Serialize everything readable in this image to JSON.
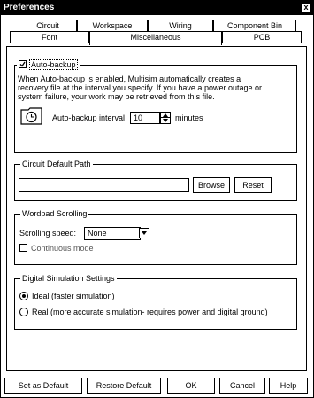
{
  "window": {
    "title": "Preferences",
    "close_label": "x"
  },
  "tabs": {
    "row1": [
      "Circuit",
      "Workspace",
      "Wiring",
      "Component Bin"
    ],
    "row2": [
      "Font",
      "Miscellaneous",
      "PCB"
    ],
    "active": "Miscellaneous"
  },
  "autobackup": {
    "label": "Auto-backup",
    "checked": true,
    "description": [
      "When Auto-backup is enabled, Multisim automatically creates a",
      "recovery file at the interval you specify. If you have a power outage or",
      "system failure, your work may be retrieved from this file."
    ],
    "interval_label": "Auto-backup interval",
    "interval_value": "10",
    "interval_unit": "minutes",
    "icon": "clock-icon"
  },
  "circuit_path": {
    "label": "Circuit Default Path",
    "value": "",
    "browse_label": "Browse",
    "reset_label": "Reset"
  },
  "wordpad": {
    "label": "Wordpad Scrolling",
    "speed_label": "Scrolling speed:",
    "speed_value": "None",
    "continuous_label": "Continuous mode",
    "continuous_checked": false
  },
  "digital_sim": {
    "label": "Digital Simulation Settings",
    "option_ideal": "Ideal (faster simulation)",
    "option_real": "Real (more accurate simulation- requires power and digital ground)",
    "selected": "ideal"
  },
  "footer": {
    "set_default": "Set as Default",
    "restore_default": "Restore Default",
    "ok": "OK",
    "cancel": "Cancel",
    "help": "Help"
  }
}
